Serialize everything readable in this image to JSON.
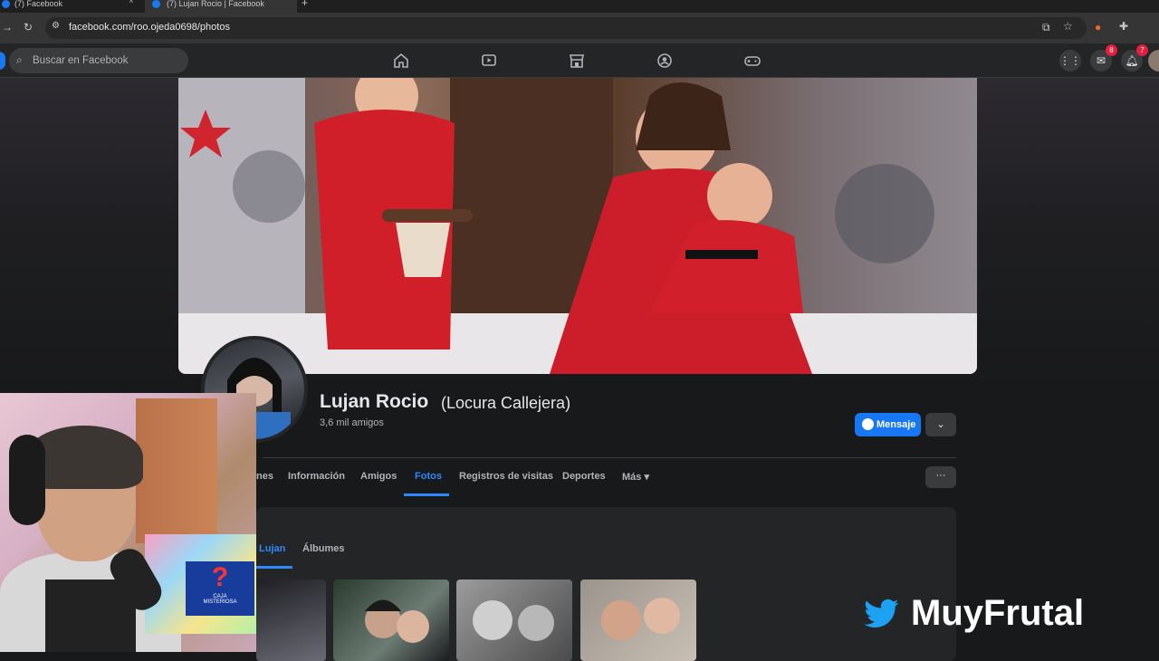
{
  "browser": {
    "tabs": [
      {
        "label": "(7) Facebook",
        "active": false
      },
      {
        "label": "(7) Lujan Rocio | Facebook",
        "active": true
      }
    ],
    "url": "facebook.com/roo.ojeda0698/photos"
  },
  "fb_header": {
    "search_placeholder": "Buscar en Facebook",
    "messenger_badge": "8",
    "notifications_badge": "7",
    "nav_icons": [
      "home-icon",
      "video-icon",
      "marketplace-icon",
      "groups-icon",
      "gaming-icon"
    ]
  },
  "profile": {
    "name": "Lujan Rocio",
    "nickname": "(Locura Callejera)",
    "friends": "3,6 mil amigos",
    "message_button": "Mensaje"
  },
  "profile_tabs": {
    "partial_first": "nes",
    "info": "Información",
    "friends": "Amigos",
    "photos": "Fotos",
    "visits": "Registros de visitas",
    "sports": "Deportes",
    "more": "Más ▾"
  },
  "photos_card": {
    "tab_active": "Lujan",
    "tab_albums": "Álbumes"
  },
  "webcam_overlay": {
    "box_text_1": "CAJA",
    "box_text_2": "MISTERIOSA",
    "box_mark": "?"
  },
  "watermark": {
    "text": "MuyFrutal"
  },
  "colors": {
    "fb_blue": "#1877f2",
    "active_tab": "#2d88ff",
    "header_bg": "#242526"
  }
}
